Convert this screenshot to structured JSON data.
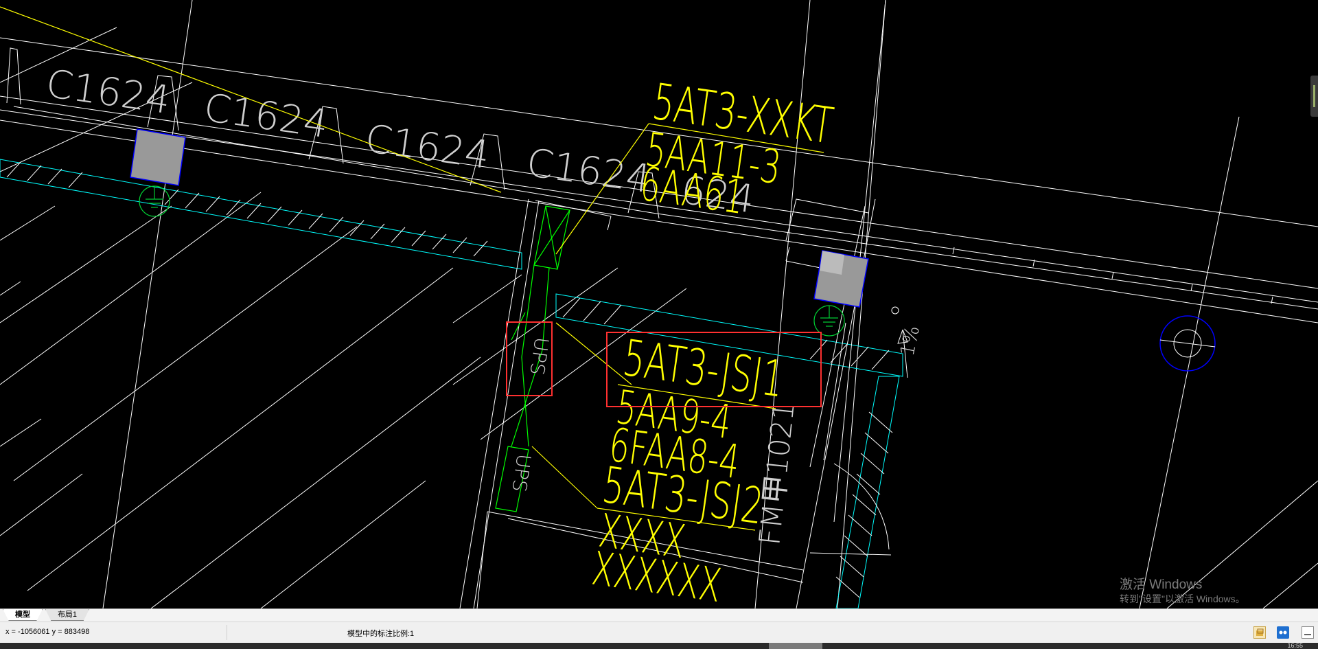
{
  "drawing": {
    "labels": {
      "window_type": "C1624",
      "panel_main": "5AT3-XXKT",
      "panel_main_sub1": "5AA11-3",
      "panel_main_sub2": "6AA61",
      "panel_main_sub2_overlap": "624",
      "panel_jsj1": "5AT3-JSJ1",
      "panel_jsj1_sub1": "5AA9-4",
      "panel_jsj1_sub2": "6FAA8-4",
      "panel_jsj2": "5AT3-JSJ2",
      "panel_jsj2_sub1": "XXXX",
      "panel_jsj2_sub2": "XXXXXX",
      "ups": "UPS",
      "door": "FM甲1021",
      "slope": "1%"
    },
    "colors": {
      "background": "#000000",
      "line": "#ffffff",
      "text_gray": "#cfcfcf",
      "annotation": "#ffff00",
      "wall_hatch": "#00ffff",
      "cable": "#00ff00",
      "highlight": "#ff3030",
      "column": "#999999",
      "drain": "#0000ff"
    }
  },
  "tabs": {
    "model": "模型",
    "layout1": "布局1"
  },
  "status": {
    "coordinates": "x = -1056061  y = 883498",
    "annotation_scale": "模型中的标注比例:1"
  },
  "watermark": {
    "title": "激活 Windows",
    "subtitle": "转到\"设置\"以激活 Windows。"
  },
  "clock": "16:55"
}
